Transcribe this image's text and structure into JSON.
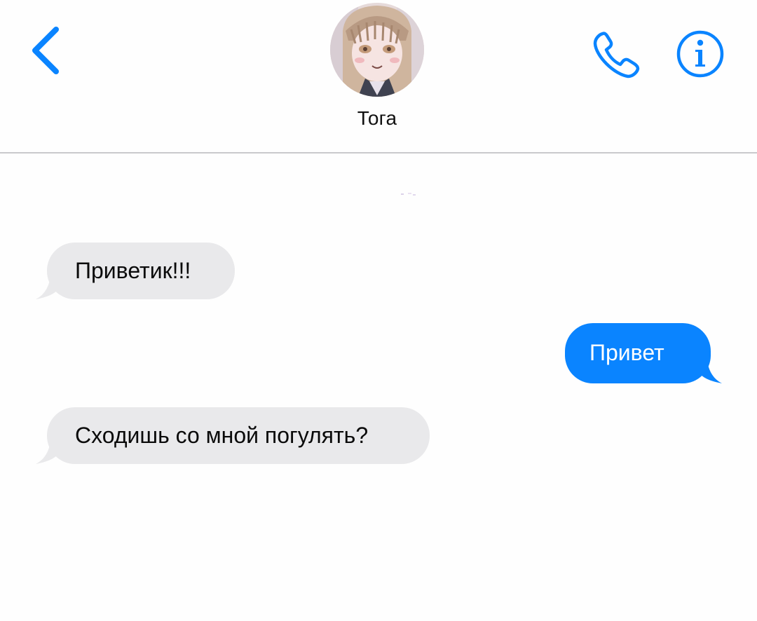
{
  "header": {
    "contact_name": "Тога",
    "back_icon": "chevron-left-icon",
    "call_icon": "phone-icon",
    "info_icon": "info-icon"
  },
  "colors": {
    "accent": "#0a84ff",
    "incoming_bubble": "#e9e9eb",
    "outgoing_bubble": "#0a84ff",
    "divider": "#c9c9cc"
  },
  "messages": [
    {
      "direction": "incoming",
      "text": "Приветик!!!"
    },
    {
      "direction": "outgoing",
      "text": "Привет"
    },
    {
      "direction": "incoming",
      "text": "Сходишь со мной погулять?"
    }
  ]
}
